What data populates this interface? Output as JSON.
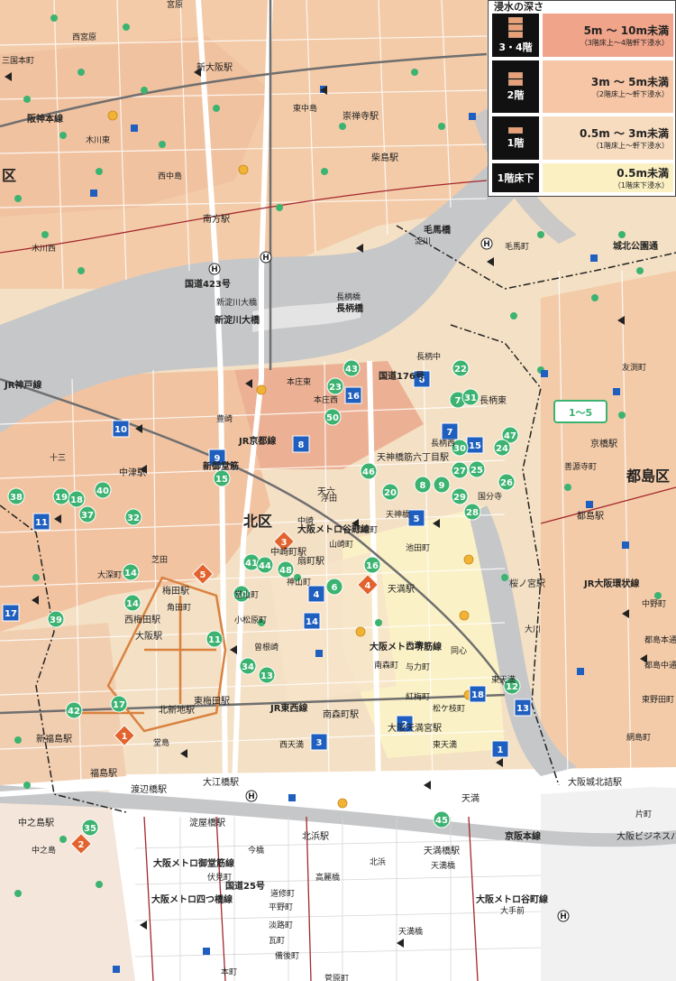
{
  "legend": {
    "title": "浸水の深さ",
    "rows": [
      {
        "floor": "3・4階",
        "depth": "5m ～ 10m未満",
        "note": "（3階床上～4階軒下浸水）",
        "color": "#f0a48a"
      },
      {
        "floor": "2階",
        "depth": "3m ～ 5m未満",
        "note": "（2階床上～軒下浸水）",
        "color": "#f6c6a6"
      },
      {
        "floor": "1階",
        "depth": "0.5m ～ 3m未満",
        "note": "（1階床上～軒下浸水）",
        "color": "#f8dcc0"
      },
      {
        "floor": "1階床下",
        "depth": "0.5m未満",
        "note": "（1階床下浸水）",
        "color": "#fbf0c2"
      }
    ]
  },
  "map": {
    "colors": {
      "river": "#c8c9cb",
      "flood_high": "#eba58a",
      "flood_mid": "#f3c7a8",
      "flood_low": "#f7dcc0",
      "flood_yellow": "#fbf3c8",
      "no_flood": "#ffffff",
      "shelter": "#3cb371",
      "facility": "#1f5fbf",
      "danger": "#e2632e",
      "rail": "#7a2d2d"
    },
    "ward_labels": [
      "北区",
      "都島区",
      "区"
    ],
    "station_labels": [
      "新大阪駅",
      "崇禅寺駅",
      "柴島駅",
      "南方駅",
      "中津駅",
      "天神橋筋六丁目駅",
      "扇町駅",
      "天満駅",
      "都島駅",
      "桜ノ宮駅",
      "大阪駅",
      "梅田駅",
      "東梅田駅",
      "西梅田駅",
      "北新地駅",
      "南森町駅",
      "大阪天満宮駅",
      "天満橋駅",
      "京橋駅",
      "大阪城北詰駅",
      "大江橋駅",
      "渡辺橋駅",
      "淀屋橋駅",
      "北浜駅",
      "新福島駅",
      "福島駅",
      "中之島駅",
      "天六",
      "天満",
      "中崎町駅",
      "長柄東",
      "大阪ビジネスパーク駅"
    ],
    "place_labels": [
      "宮原",
      "西宮原",
      "三国本町",
      "東中島",
      "西中島",
      "木川東",
      "木川西",
      "十三",
      "豊崎",
      "本庄東",
      "本庄西",
      "浮田",
      "池田町",
      "長柄中",
      "長柄西",
      "天神橋",
      "国分寺",
      "中崎",
      "黒崎町",
      "山崎町",
      "神山町",
      "堂山町",
      "小松原町",
      "角田町",
      "芝田",
      "大深町",
      "中之島",
      "堂島",
      "曾根崎",
      "西天満",
      "東天満",
      "南森町",
      "天満",
      "松ケ枝町",
      "紅梅町",
      "与力町",
      "同心",
      "天満橋",
      "北浜",
      "今橋",
      "高麗橋",
      "伏見町",
      "道修町",
      "平野町",
      "淡路町",
      "瓦町",
      "備後町",
      "本町",
      "大手前",
      "片町",
      "網島町",
      "東野田町",
      "中野町",
      "友渕町",
      "毛馬町",
      "善源寺町",
      "都島本通",
      "都島中通",
      "東天満",
      "大川",
      "淀川",
      "新淀川大橋",
      "長柄橋",
      "菅原町",
      "天満橋"
    ],
    "route_labels": [
      "新淀川大橋",
      "長柄橋",
      "毛馬橋",
      "大阪メトロ堺筋線",
      "大阪メトロ谷町線",
      "大阪メトロ御堂筋線",
      "大阪メトロ四つ橋線",
      "大阪メトロ谷町線",
      "JR京都線",
      "JR東西線",
      "JR大阪環状線",
      "JR神戸線",
      "阪神本線",
      "京阪本線",
      "国道176号",
      "国道423号",
      "国道25号",
      "新御堂筋",
      "城北公園通"
    ],
    "numbered_markers": [
      {
        "n": "43",
        "c": "g"
      },
      {
        "n": "23",
        "c": "g"
      },
      {
        "n": "16",
        "c": "b"
      },
      {
        "n": "6",
        "c": "b"
      },
      {
        "n": "22",
        "c": "g"
      },
      {
        "n": "7",
        "c": "g"
      },
      {
        "n": "31",
        "c": "g"
      },
      {
        "n": "50",
        "c": "g"
      },
      {
        "n": "10",
        "c": "b"
      },
      {
        "n": "8",
        "c": "b"
      },
      {
        "n": "7",
        "c": "b"
      },
      {
        "n": "15",
        "c": "b"
      },
      {
        "n": "47",
        "c": "g"
      },
      {
        "n": "24",
        "c": "g"
      },
      {
        "n": "30",
        "c": "g"
      },
      {
        "n": "9",
        "c": "b"
      },
      {
        "n": "15",
        "c": "g"
      },
      {
        "n": "46",
        "c": "g"
      },
      {
        "n": "27",
        "c": "g"
      },
      {
        "n": "25",
        "c": "g"
      },
      {
        "n": "26",
        "c": "g"
      },
      {
        "n": "38",
        "c": "g"
      },
      {
        "n": "19",
        "c": "g"
      },
      {
        "n": "18",
        "c": "g"
      },
      {
        "n": "40",
        "c": "g"
      },
      {
        "n": "37",
        "c": "g"
      },
      {
        "n": "20",
        "c": "g"
      },
      {
        "n": "8",
        "c": "g"
      },
      {
        "n": "9",
        "c": "g"
      },
      {
        "n": "29",
        "c": "g"
      },
      {
        "n": "28",
        "c": "g"
      },
      {
        "n": "11",
        "c": "b"
      },
      {
        "n": "32",
        "c": "g"
      },
      {
        "n": "5",
        "c": "b"
      },
      {
        "n": "3",
        "c": "o"
      },
      {
        "n": "41",
        "c": "g"
      },
      {
        "n": "44",
        "c": "g"
      },
      {
        "n": "48",
        "c": "g"
      },
      {
        "n": "16",
        "c": "g"
      },
      {
        "n": "4",
        "c": "o"
      },
      {
        "n": "14",
        "c": "g"
      },
      {
        "n": "5",
        "c": "o"
      },
      {
        "n": "6",
        "c": "g"
      },
      {
        "n": "4",
        "c": "b"
      },
      {
        "n": "10",
        "c": "g"
      },
      {
        "n": "17",
        "c": "b"
      },
      {
        "n": "14",
        "c": "g"
      },
      {
        "n": "39",
        "c": "g"
      },
      {
        "n": "14",
        "c": "b"
      },
      {
        "n": "11",
        "c": "g"
      },
      {
        "n": "34",
        "c": "g"
      },
      {
        "n": "13",
        "c": "g"
      },
      {
        "n": "12",
        "c": "g"
      },
      {
        "n": "18",
        "c": "b"
      },
      {
        "n": "42",
        "c": "g"
      },
      {
        "n": "17",
        "c": "g"
      },
      {
        "n": "2",
        "c": "b"
      },
      {
        "n": "13",
        "c": "b"
      },
      {
        "n": "1",
        "c": "o"
      },
      {
        "n": "3",
        "c": "b"
      },
      {
        "n": "1",
        "c": "b"
      },
      {
        "n": "45",
        "c": "g"
      },
      {
        "n": "35",
        "c": "g"
      },
      {
        "n": "2",
        "c": "o"
      }
    ],
    "range_badge": "1～5"
  }
}
